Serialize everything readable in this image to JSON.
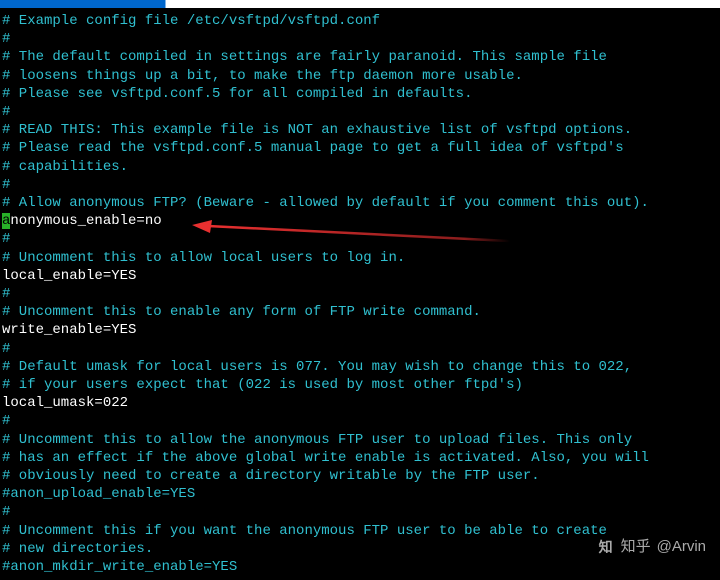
{
  "lines": [
    {
      "type": "comment",
      "text": "# Example config file /etc/vsftpd/vsftpd.conf"
    },
    {
      "type": "comment",
      "text": "#"
    },
    {
      "type": "comment",
      "text": "# The default compiled in settings are fairly paranoid. This sample file"
    },
    {
      "type": "comment",
      "text": "# loosens things up a bit, to make the ftp daemon more usable."
    },
    {
      "type": "comment",
      "text": "# Please see vsftpd.conf.5 for all compiled in defaults."
    },
    {
      "type": "comment",
      "text": "#"
    },
    {
      "type": "comment",
      "text": "# READ THIS: This example file is NOT an exhaustive list of vsftpd options."
    },
    {
      "type": "comment",
      "text": "# Please read the vsftpd.conf.5 manual page to get a full idea of vsftpd's"
    },
    {
      "type": "comment",
      "text": "# capabilities."
    },
    {
      "type": "comment",
      "text": "#"
    },
    {
      "type": "comment",
      "text": "# Allow anonymous FTP? (Beware - allowed by default if you comment this out)."
    },
    {
      "type": "cursor-line",
      "cursor_char": "a",
      "rest": "nonymous_enable=no"
    },
    {
      "type": "comment",
      "text": "#"
    },
    {
      "type": "comment",
      "text": "# Uncomment this to allow local users to log in."
    },
    {
      "type": "plain",
      "text": "local_enable=YES"
    },
    {
      "type": "comment",
      "text": "#"
    },
    {
      "type": "comment",
      "text": "# Uncomment this to enable any form of FTP write command."
    },
    {
      "type": "plain",
      "text": "write_enable=YES"
    },
    {
      "type": "comment",
      "text": "#"
    },
    {
      "type": "comment",
      "text": "# Default umask for local users is 077. You may wish to change this to 022,"
    },
    {
      "type": "comment",
      "text": "# if your users expect that (022 is used by most other ftpd's)"
    },
    {
      "type": "plain",
      "text": "local_umask=022"
    },
    {
      "type": "comment",
      "text": "#"
    },
    {
      "type": "comment",
      "text": "# Uncomment this to allow the anonymous FTP user to upload files. This only"
    },
    {
      "type": "comment",
      "text": "# has an effect if the above global write enable is activated. Also, you will"
    },
    {
      "type": "comment",
      "text": "# obviously need to create a directory writable by the FTP user."
    },
    {
      "type": "comment",
      "text": "#anon_upload_enable=YES"
    },
    {
      "type": "comment",
      "text": "#"
    },
    {
      "type": "comment",
      "text": "# Uncomment this if you want the anonymous FTP user to be able to create"
    },
    {
      "type": "comment",
      "text": "# new directories."
    },
    {
      "type": "comment",
      "text": "#anon_mkdir_write_enable=YES"
    }
  ],
  "watermark": {
    "site": "知乎",
    "author": "@Arvin"
  },
  "arrow_color": "#e83030"
}
